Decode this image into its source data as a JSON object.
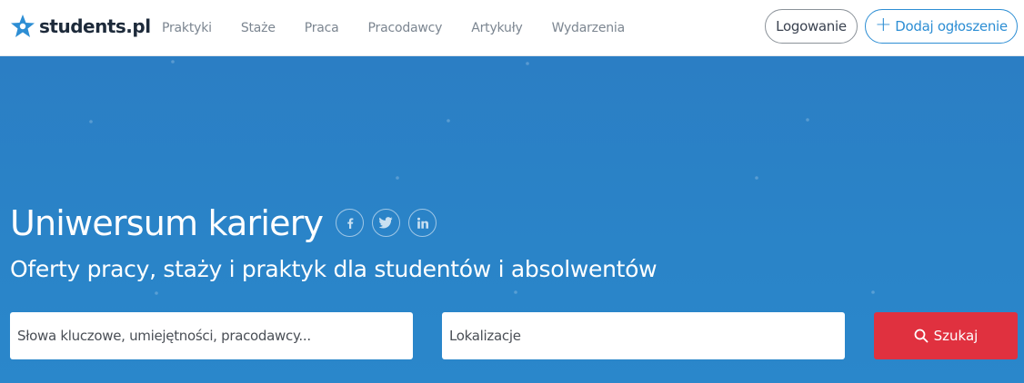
{
  "brand": {
    "name": "students.pl",
    "accent": "#2d8ed4",
    "search_color": "#e0313f"
  },
  "nav": {
    "items": [
      "Praktyki",
      "Staże",
      "Praca",
      "Pracodawcy",
      "Artykuły",
      "Wydarzenia"
    ]
  },
  "header": {
    "login_label": "Logowanie",
    "add_label": "Dodaj ogłoszenie"
  },
  "hero": {
    "title": "Uniwersum kariery",
    "subtitle": "Oferty pracy, staży i praktyk dla studentów i absolwentów",
    "social": [
      "facebook-icon",
      "twitter-icon",
      "linkedin-icon"
    ]
  },
  "search": {
    "keywords_placeholder": "Słowa kluczowe, umiejętności, pracodawcy...",
    "location_placeholder": "Lokalizacje",
    "button_label": "Szukaj"
  }
}
